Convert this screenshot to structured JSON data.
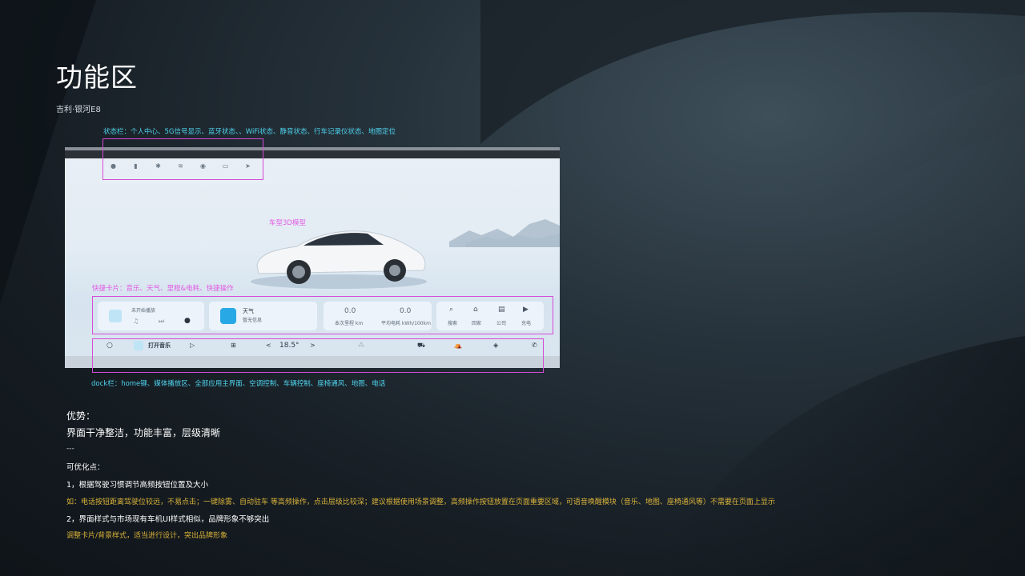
{
  "page": {
    "title": "功能区",
    "subtitle": "吉利·银河E8"
  },
  "annotations": {
    "statusbar": "状态栏：个人中心、5G信号显示、蓝牙状态、、WiFi状态、静音状态、行车记录仪状态、地图定位",
    "car_model": "车型3D模型",
    "quick_cards": "快捷卡片：音乐、天气、里程&电耗、快捷操作",
    "dock": "dock栏：home键、媒体播放区、全部应用主界面、空调控制、车辆控制、座椅通风、地图、电话"
  },
  "screen": {
    "music_card_label": "未开始播放",
    "weather_card_title": "天气",
    "weather_card_sub": "暂无信息",
    "mileage_value": "0.0",
    "mileage_label": "本次里程 km",
    "energy_value": "0.0",
    "energy_label": "平均电耗 kWh/100km",
    "quick_search": "搜索",
    "quick_home": "回家",
    "quick_company": "公司",
    "quick_charge": "充电",
    "dock_music": "打开音乐",
    "dock_temp": "18.5°",
    "dock_prev": "<",
    "dock_next": ">"
  },
  "notes": {
    "pros_heading": "优势：",
    "pros_text": "界面干净整洁，功能丰富，层级清晰",
    "divider": "---",
    "improve_heading": "可优化点：",
    "item1": "1，根据驾驶习惯调节高频按钮位置及大小",
    "item1_detail": "如：电话按钮距离驾驶位较远，不易点击；一键除雾、自动驻车 等高频操作，点击层级比较深；建议根据使用场景调整，高频操作按钮放置在页面重要区域，可语音唤醒模块（音乐、地图、座椅通风等）不需要在页面上显示",
    "item2": "2，界面样式与市场现有车机UI样式相似，品牌形象不够突出",
    "item2_detail": "调整卡片/背景样式，适当进行设计，突出品牌形象"
  },
  "colors": {
    "annotation_cyan": "#4fd3ee",
    "annotation_magenta": "#e25be4",
    "detail_yellow": "#d9b23a"
  }
}
